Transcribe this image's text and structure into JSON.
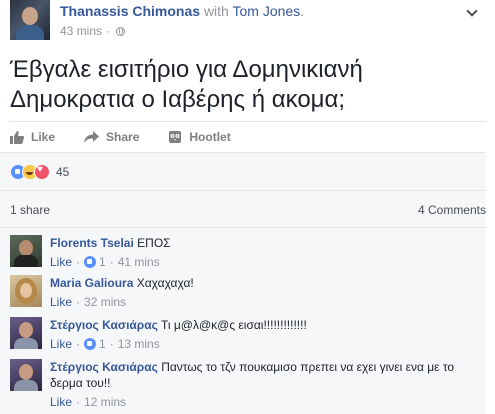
{
  "post": {
    "author": "Thanassis Chimonas",
    "with_text": "with",
    "tagged": "Tom Jones",
    "tagged_suffix": ".",
    "time": "43 mins",
    "privacy_separator": "·",
    "text": "Έβγαλε εισιτήριο για Δομηνικιανή Δημοκρατια ο Ιαβέρης ή ακομα;"
  },
  "actions": {
    "like": "Like",
    "share": "Share",
    "hootlet": "Hootlet"
  },
  "reactions": {
    "count": "45",
    "types": [
      "like",
      "haha",
      "love"
    ]
  },
  "stats": {
    "shares": "1 share",
    "comments": "4 Comments"
  },
  "comments": [
    {
      "name": "Florents Tselai",
      "text": "ΕΠΟΣ",
      "like": "Like",
      "likes": "1",
      "time": "41 mins"
    },
    {
      "name": "Maria Galioura",
      "text": "Χαχαχαχα!",
      "like": "Like",
      "likes": "",
      "time": "32 mins"
    },
    {
      "name": "Στέργιος Κασιάρας",
      "text": "Τι μ@λ@κ@ς εισαι!!!!!!!!!!!!!",
      "like": "Like",
      "likes": "1",
      "time": "13 mins"
    },
    {
      "name": "Στέργιος Κασιάρας",
      "text": "Παντως το τζν πουκαμισο πρεπει να εχει γινει ενα με το δερμα του!!",
      "like": "Like",
      "likes": "",
      "time": "12 mins"
    }
  ],
  "meta_separator": "·",
  "colors": {
    "link": "#365899",
    "muted": "#90949c",
    "like_blue": "#5890ff",
    "love_red": "#f25268",
    "haha_yellow": "#f7c948"
  }
}
